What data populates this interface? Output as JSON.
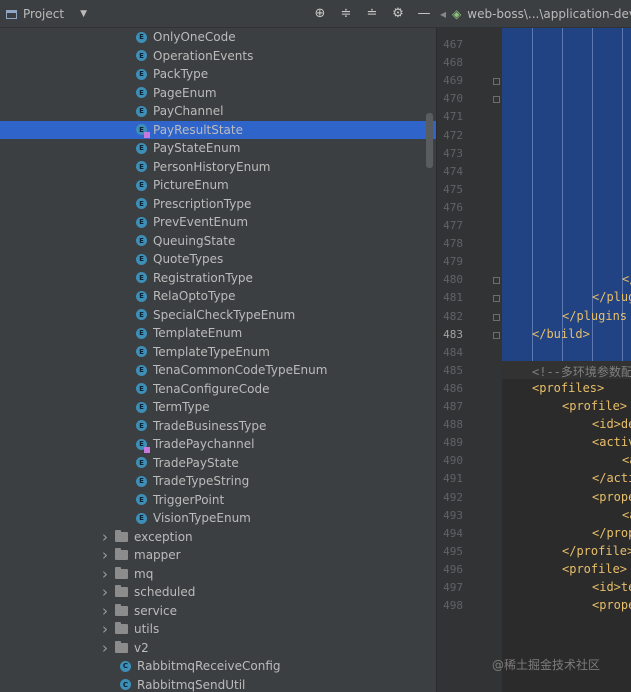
{
  "toolbar": {
    "project_label": "Project",
    "editor_tab": "web-boss\\...\\application-dev"
  },
  "tree": {
    "enums": [
      {
        "label": "OnlyOneCode",
        "icon": "enum-icon",
        "selected": false,
        "badge": false
      },
      {
        "label": "OperationEvents",
        "icon": "enum-icon",
        "selected": false,
        "badge": false
      },
      {
        "label": "PackType",
        "icon": "enum-icon",
        "selected": false,
        "badge": false
      },
      {
        "label": "PageEnum",
        "icon": "enum-icon",
        "selected": false,
        "badge": false
      },
      {
        "label": "PayChannel",
        "icon": "enum-icon",
        "selected": false,
        "badge": false
      },
      {
        "label": "PayResultState",
        "icon": "enum-icon",
        "selected": true,
        "badge": true
      },
      {
        "label": "PayStateEnum",
        "icon": "enum-icon",
        "selected": false,
        "badge": false
      },
      {
        "label": "PersonHistoryEnum",
        "icon": "enum-icon",
        "selected": false,
        "badge": false
      },
      {
        "label": "PictureEnum",
        "icon": "enum-icon",
        "selected": false,
        "badge": false
      },
      {
        "label": "PrescriptionType",
        "icon": "enum-icon",
        "selected": false,
        "badge": false
      },
      {
        "label": "PrevEventEnum",
        "icon": "enum-icon",
        "selected": false,
        "badge": false
      },
      {
        "label": "QueuingState",
        "icon": "enum-icon",
        "selected": false,
        "badge": false
      },
      {
        "label": "QuoteTypes",
        "icon": "enum-icon",
        "selected": false,
        "badge": false
      },
      {
        "label": "RegistrationType",
        "icon": "enum-icon",
        "selected": false,
        "badge": false
      },
      {
        "label": "RelaOptoType",
        "icon": "enum-icon",
        "selected": false,
        "badge": false
      },
      {
        "label": "SpecialCheckTypeEnum",
        "icon": "enum-icon",
        "selected": false,
        "badge": false
      },
      {
        "label": "TemplateEnum",
        "icon": "enum-icon",
        "selected": false,
        "badge": false
      },
      {
        "label": "TemplateTypeEnum",
        "icon": "enum-icon",
        "selected": false,
        "badge": false
      },
      {
        "label": "TenaCommonCodeTypeEnum",
        "icon": "enum-icon",
        "selected": false,
        "badge": false
      },
      {
        "label": "TenaConfigureCode",
        "icon": "enum-icon",
        "selected": false,
        "badge": false
      },
      {
        "label": "TermType",
        "icon": "enum-icon",
        "selected": false,
        "badge": false
      },
      {
        "label": "TradeBusinessType",
        "icon": "enum-icon",
        "selected": false,
        "badge": false
      },
      {
        "label": "TradePaychannel",
        "icon": "enum-icon",
        "selected": false,
        "badge": true
      },
      {
        "label": "TradePayState",
        "icon": "enum-icon",
        "selected": false,
        "badge": false
      },
      {
        "label": "TradeTypeString",
        "icon": "enum-icon",
        "selected": false,
        "badge": false
      },
      {
        "label": "TriggerPoint",
        "icon": "enum-icon",
        "selected": false,
        "badge": false
      },
      {
        "label": "VisionTypeEnum",
        "icon": "enum-icon",
        "selected": false,
        "badge": false
      }
    ],
    "folders": [
      {
        "label": "exception"
      },
      {
        "label": "mapper"
      },
      {
        "label": "mq"
      },
      {
        "label": "scheduled"
      },
      {
        "label": "service"
      },
      {
        "label": "utils"
      },
      {
        "label": "v2"
      }
    ],
    "classes": [
      {
        "label": "RabbitmqReceiveConfig"
      },
      {
        "label": "RabbitmqSendUtil"
      }
    ]
  },
  "editor": {
    "current_line": "483",
    "line_numbers": [
      "467",
      "468",
      "469",
      "470",
      "471",
      "472",
      "473",
      "474",
      "475",
      "476",
      "477",
      "478",
      "479",
      "480",
      "481",
      "482",
      "483",
      "484",
      "485",
      "486",
      "487",
      "488",
      "489",
      "490",
      "491",
      "492",
      "493",
      "494",
      "495",
      "496",
      "497",
      "498"
    ],
    "code_lines": [
      {
        "text": "",
        "indent": 0
      },
      {
        "text": "",
        "indent": 0
      },
      {
        "text": "",
        "indent": 0
      },
      {
        "text": "",
        "indent": 0
      },
      {
        "text": "",
        "indent": 0
      },
      {
        "text": "",
        "indent": 0
      },
      {
        "text": "",
        "indent": 0
      },
      {
        "text": "",
        "indent": 0
      },
      {
        "text": "",
        "indent": 0
      },
      {
        "text": "",
        "indent": 0
      },
      {
        "text": "",
        "indent": 0
      },
      {
        "text": "",
        "indent": 0
      },
      {
        "text": "",
        "indent": 0
      },
      {
        "text": "</",
        "indent": 6
      },
      {
        "text": "</plug",
        "indent": 5
      },
      {
        "text": "</plugins",
        "indent": 4
      },
      {
        "text": "</build>",
        "indent": 3
      },
      {
        "text": "",
        "indent": 0
      },
      {
        "text": "<!--多环境参数配",
        "indent": 3,
        "comment": true
      },
      {
        "text": "<profiles>",
        "indent": 3
      },
      {
        "text": "<profile>",
        "indent": 4
      },
      {
        "text": "<id>de",
        "indent": 5
      },
      {
        "text": "<activ",
        "indent": 5
      },
      {
        "text": "<a",
        "indent": 6
      },
      {
        "text": "</acti",
        "indent": 5
      },
      {
        "text": "<prope",
        "indent": 5
      },
      {
        "text": "<a",
        "indent": 6
      },
      {
        "text": "</prop",
        "indent": 5
      },
      {
        "text": "</profile>",
        "indent": 4
      },
      {
        "text": "<profile>",
        "indent": 4
      },
      {
        "text": "<id>te",
        "indent": 5
      },
      {
        "text": "<prope",
        "indent": 5
      }
    ]
  },
  "watermark": "@稀土掘金技术社区",
  "colors": {
    "selection": "#2f65ca",
    "code_selection": "#214283",
    "tag": "#e8bf6a",
    "comment": "#808080"
  }
}
